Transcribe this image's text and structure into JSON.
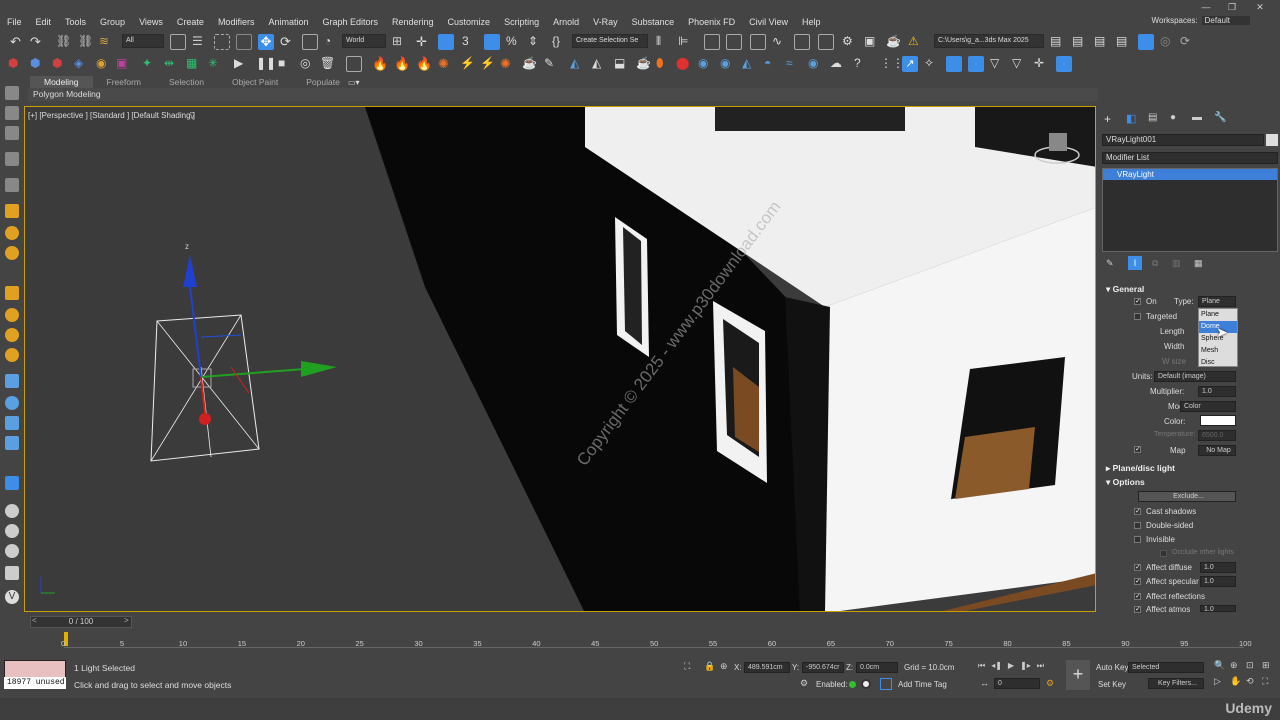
{
  "menu": [
    "File",
    "Edit",
    "Tools",
    "Group",
    "Views",
    "Create",
    "Modifiers",
    "Animation",
    "Graph Editors",
    "Rendering",
    "Customize",
    "Scripting",
    "Arnold",
    "V-Ray",
    "Substance",
    "Phoenix FD",
    "Civil View",
    "Help"
  ],
  "workspaces": {
    "label": "Workspaces:",
    "value": "Default"
  },
  "toolbar": {
    "filter_dropdown": "All",
    "coord_dropdown": "World",
    "selection_set": "Create Selection Se",
    "path_field": "C:\\Users\\g_a...3ds Max 2025"
  },
  "ribbon": {
    "tabs": [
      "Modeling",
      "Freeform",
      "Selection",
      "Object Paint",
      "Populate"
    ],
    "active_tab": "Modeling",
    "sub_label": "Polygon Modeling"
  },
  "viewport": {
    "label": "[+] [Perspective ] [Standard ] [Default Shading ]",
    "watermark": "Copyright © 2025 - www.p30download.com",
    "axis_z": "z"
  },
  "panel": {
    "object_name": "VRayLight001",
    "modifier_list": "Modifier List",
    "stack_item": "VRayLight",
    "general_title": "General",
    "on_label": "On",
    "type_label": "Type:",
    "type_value": "Plane",
    "targeted_label": "Targeted",
    "length_label": "Length",
    "width_label": "Width",
    "wsize_label": "W size",
    "type_options": [
      "Plane",
      "Dome",
      "Sphere",
      "Mesh",
      "Disc"
    ],
    "type_highlight_index": 1,
    "units_label": "Units:",
    "units_value": "Default (image)",
    "multiplier_label": "Multiplier:",
    "multiplier_value": "1.0",
    "mode_label": "Mode:",
    "mode_value": "Color",
    "color_label": "Color:",
    "temperature_label": "Temperature:",
    "temperature_value": "6500.0",
    "map_label": "Map",
    "map_value": "No Map",
    "plane_disc_title": "Plane/disc light",
    "options_title": "Options",
    "exclude_button": "Exclude...",
    "cast_shadows": "Cast shadows",
    "double_sided": "Double-sided",
    "invisible": "Invisible",
    "occlude": "Occlude other lights",
    "affect_diffuse": "Affect diffuse",
    "affect_diffuse_value": "1.0",
    "affect_specular": "Affect specular",
    "affect_specular_value": "1.0",
    "affect_reflections": "Affect reflections",
    "affect_atmos": "Affect atmos",
    "affect_atmos_value": "1.0"
  },
  "timeline": {
    "frame_counter": "0 / 100",
    "ticks": [
      "0",
      "5",
      "10",
      "15",
      "20",
      "25",
      "30",
      "35",
      "40",
      "45",
      "50",
      "55",
      "60",
      "65",
      "70",
      "75",
      "80",
      "85",
      "90",
      "95",
      "100"
    ]
  },
  "status": {
    "unused": "18977 unused",
    "selected": "1 Light Selected",
    "hint": "Click and drag to select and move objects",
    "x_label": "X:",
    "x_value": "489.591cm",
    "y_label": "Y:",
    "y_value": "-950.674cr",
    "z_label": "Z:",
    "z_value": "0.0cm",
    "grid": "Grid = 10.0cm",
    "enabled": "Enabled:",
    "add_time_tag": "Add Time Tag",
    "auto_key": "Auto Key",
    "auto_key_dropdown": "Selected",
    "set_key": "Set Key",
    "key_filters": "Key Filters...",
    "frame_value": "0"
  },
  "branding": "Udemy",
  "colors": {
    "accent": "#3d7fd9",
    "viewport_border": "#c8a000",
    "active_blue": "#3d8ee8"
  }
}
